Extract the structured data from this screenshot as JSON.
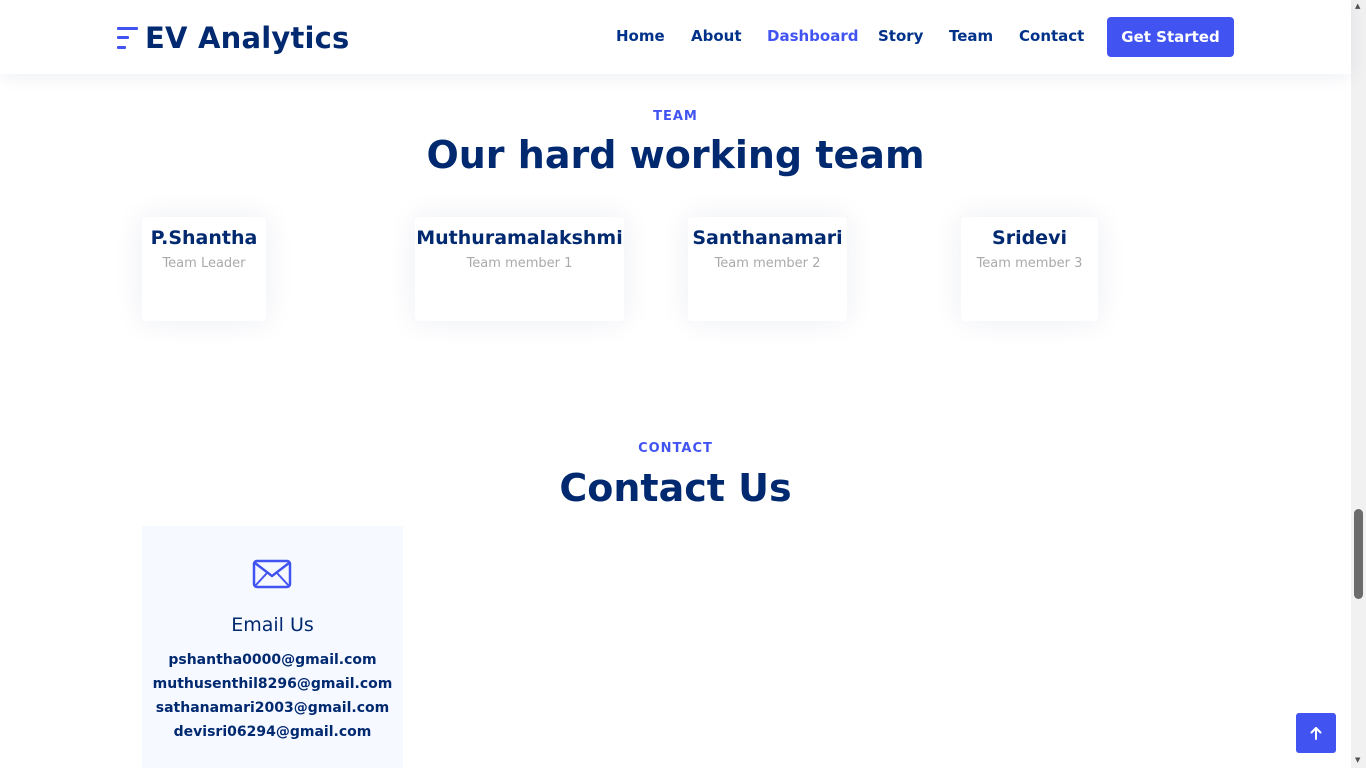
{
  "header": {
    "brand": "EV Analytics",
    "nav": [
      {
        "label": "Home"
      },
      {
        "label": "About"
      },
      {
        "label": "Dashboard",
        "active": true
      },
      {
        "label": "Story"
      },
      {
        "label": "Team"
      },
      {
        "label": "Contact"
      }
    ],
    "cta_label": "Get Started"
  },
  "team": {
    "label": "Team",
    "title": "Our hard working team",
    "members": [
      {
        "name": "P.Shantha",
        "role": "Team Leader"
      },
      {
        "name": "Muthuramalakshmi",
        "role": "Team member 1"
      },
      {
        "name": "Santhanamari",
        "role": "Team member 2"
      },
      {
        "name": "Sridevi",
        "role": "Team member 3"
      }
    ]
  },
  "contact": {
    "label": "Contact",
    "title": "Contact Us",
    "email_card": {
      "icon": "envelope-icon",
      "title": "Email Us",
      "emails": [
        "pshantha0000@gmail.com",
        "muthusenthil8296@gmail.com",
        "sathanamari2003@gmail.com",
        "devisri06294@gmail.com"
      ]
    }
  },
  "scroll_top_icon": "arrow-up-icon",
  "colors": {
    "accent": "#4154f1",
    "navy": "#012970",
    "muted": "#aaaaaa",
    "card_bg": "#f6f9ff"
  }
}
